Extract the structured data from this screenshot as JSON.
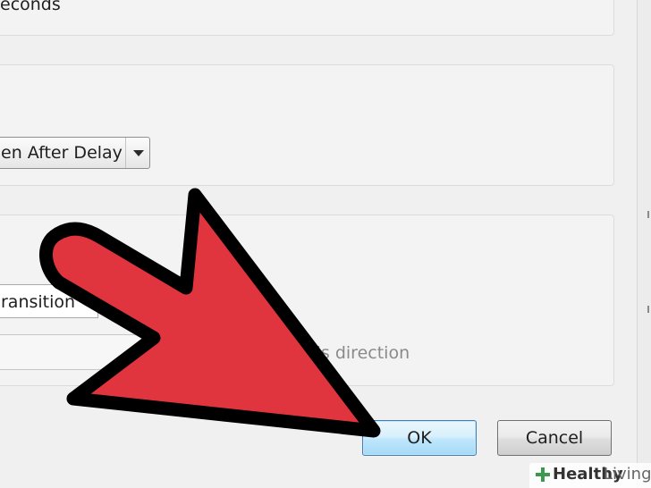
{
  "dialog": {
    "top_group": {
      "seconds_label": "econds"
    },
    "middle_group": {
      "select_value": "en After Delay"
    },
    "bottom_group": {
      "field_value": "ransition",
      "direction_label": "ols direction"
    },
    "buttons": {
      "ok_label": "OK",
      "cancel_label": "Cancel"
    }
  },
  "overlay": {
    "arrow_color": "#e0343f",
    "arrow_outline": "#000000",
    "icon": "pointer-arrow-icon"
  },
  "watermark": {
    "brand_bold": "Healthy",
    "brand_light": "Living",
    "icon": "plus-leaf-icon",
    "accent": "#3a9a4f"
  }
}
